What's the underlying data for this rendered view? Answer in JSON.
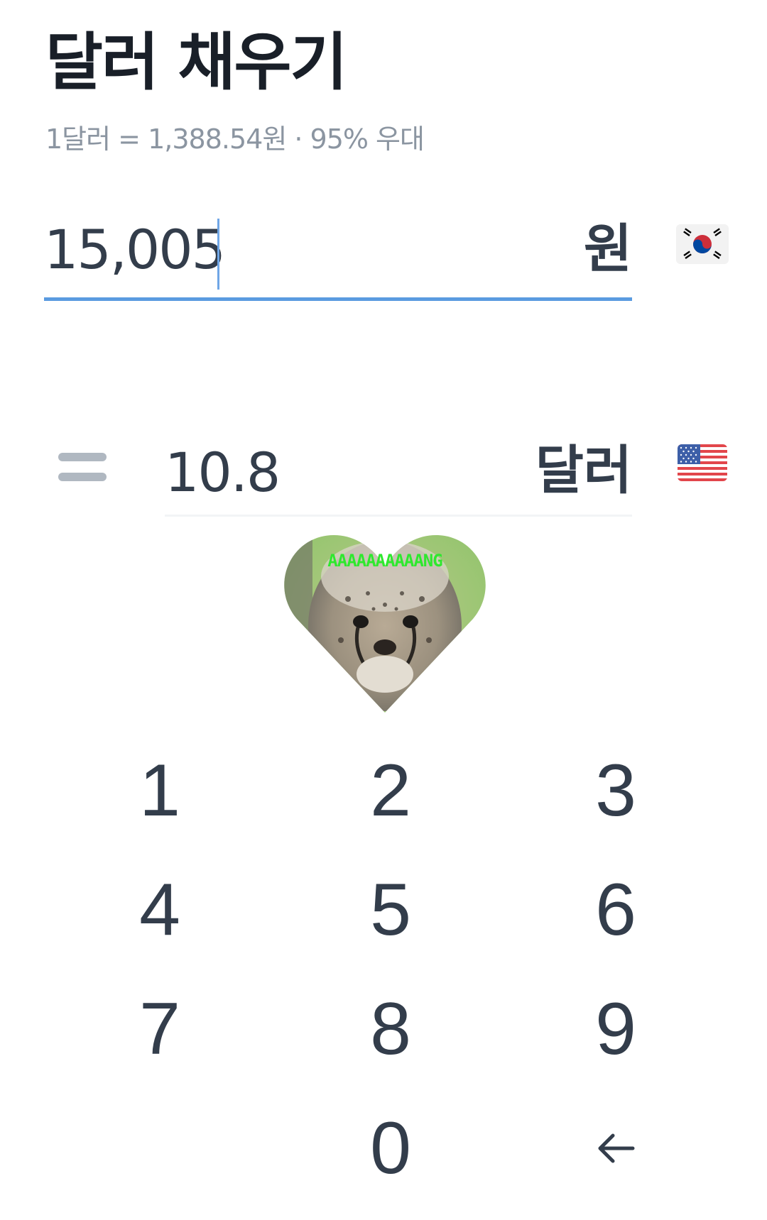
{
  "header": {
    "title": "달러 채우기",
    "rate_info": "1달러 = 1,388.54원 · 95% 우대"
  },
  "krw": {
    "value": "15,005",
    "unit": "원",
    "flag": "kr-flag-icon"
  },
  "usd": {
    "value": "10.8",
    "unit": "달러",
    "flag": "us-flag-icon"
  },
  "sticker": {
    "caption": "AAAAAAAAAANG"
  },
  "keypad": {
    "keys": [
      "1",
      "2",
      "3",
      "4",
      "5",
      "6",
      "7",
      "8",
      "9",
      "",
      "0",
      "←"
    ]
  },
  "colors": {
    "accent": "#5a9be0",
    "text": "#333d4b",
    "subtext": "#8b95a1"
  }
}
